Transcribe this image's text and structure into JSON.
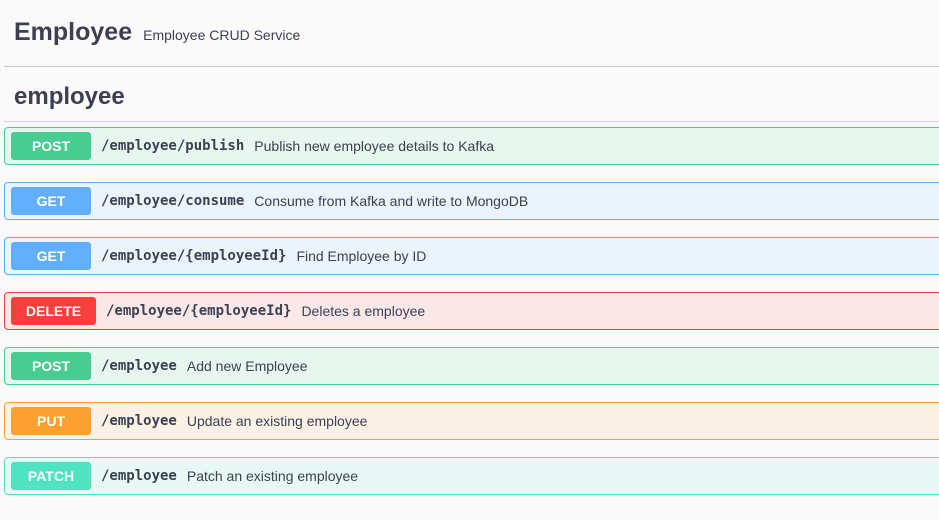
{
  "header": {
    "title": "Employee",
    "subtitle": "Employee CRUD Service"
  },
  "section": {
    "title": "employee"
  },
  "operations": [
    {
      "method": "POST",
      "path": "/employee/publish",
      "description": "Publish new employee details to Kafka"
    },
    {
      "method": "GET",
      "path": "/employee/consume",
      "description": "Consume from Kafka and write to MongoDB"
    },
    {
      "method": "GET",
      "path": "/employee/{employeeId}",
      "description": "Find Employee by ID"
    },
    {
      "method": "DELETE",
      "path": "/employee/{employeeId}",
      "description": "Deletes a employee"
    },
    {
      "method": "POST",
      "path": "/employee",
      "description": "Add new Employee"
    },
    {
      "method": "PUT",
      "path": "/employee",
      "description": "Update an existing employee"
    },
    {
      "method": "PATCH",
      "path": "/employee",
      "description": "Patch an existing employee"
    }
  ],
  "colors": {
    "post": "#49cc90",
    "get": "#61affe",
    "delete": "#f93e3e",
    "put": "#fca130",
    "patch": "#50e3c2"
  }
}
